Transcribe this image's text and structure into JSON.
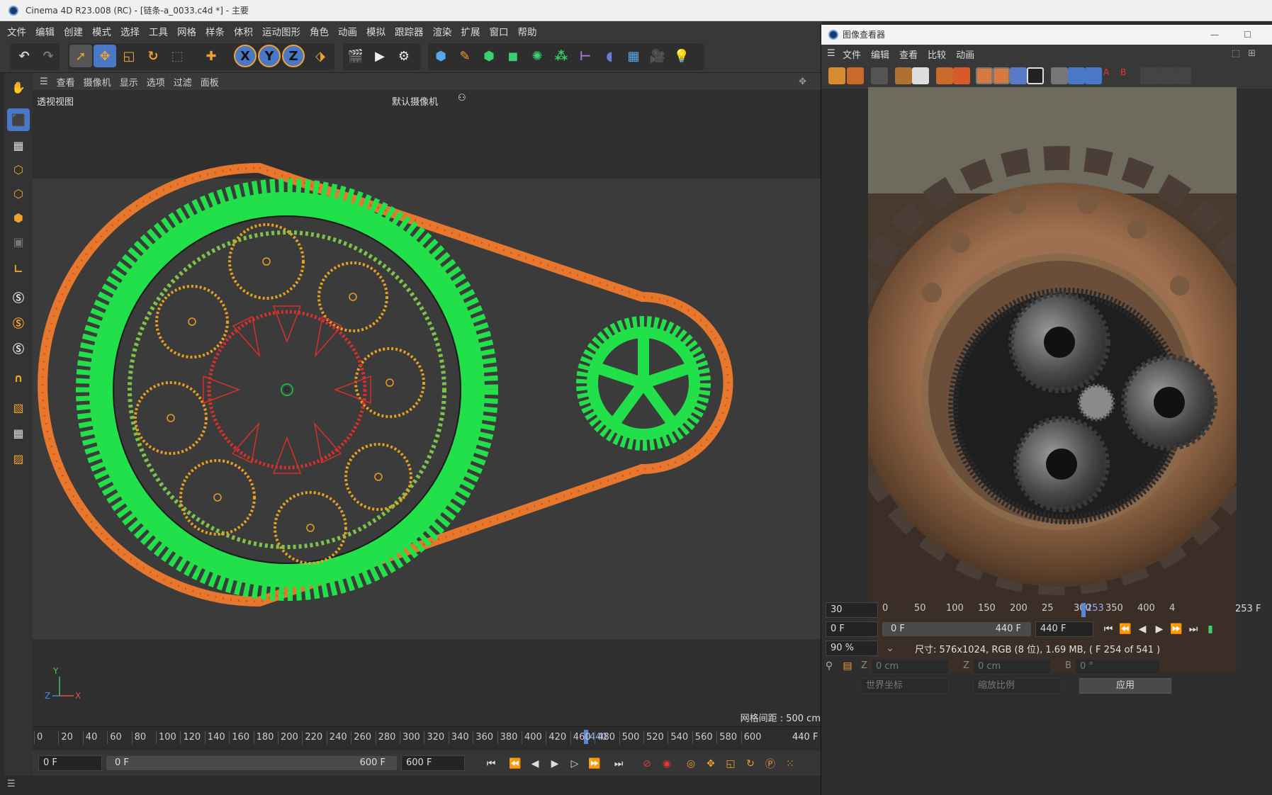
{
  "app": {
    "window_title": "Cinema 4D R23.008 (RC) - [链条-a_0033.c4d *] - 主要",
    "menu": [
      "文件",
      "编辑",
      "创建",
      "模式",
      "选择",
      "工具",
      "网格",
      "样条",
      "体积",
      "运动图形",
      "角色",
      "动画",
      "模拟",
      "跟踪器",
      "渲染",
      "扩展",
      "窗口",
      "帮助"
    ]
  },
  "toolbar": {
    "axis_x": "X",
    "axis_y": "Y",
    "axis_z": "Z"
  },
  "viewport": {
    "menu": [
      "查看",
      "摄像机",
      "显示",
      "选项",
      "过滤",
      "面板"
    ],
    "view_name": "透视视图",
    "camera_name": "默认摄像机",
    "grid_spacing": "网格间距 : 500 cm",
    "axis_x": "X",
    "axis_y": "Y",
    "axis_z": "Z"
  },
  "timeline": {
    "ticks": [
      "0",
      "20",
      "40",
      "60",
      "80",
      "100",
      "120",
      "140",
      "160",
      "180",
      "200",
      "220",
      "240",
      "260",
      "280",
      "300",
      "320",
      "340",
      "360",
      "380",
      "400",
      "420",
      "4",
      "440",
      "460",
      "480",
      "500",
      "520",
      "540",
      "560",
      "580",
      "600"
    ],
    "current_marker": "440",
    "end_label": "440 F"
  },
  "transport": {
    "start_field": "0 F",
    "range_start": "0 F",
    "range_end": "600 F",
    "end_field": "600 F"
  },
  "viewer": {
    "title": "图像查看器",
    "menu": [
      "文件",
      "编辑",
      "查看",
      "比较",
      "动画"
    ],
    "fps": "30",
    "ticks": [
      "0",
      "50",
      "100",
      "150",
      "200",
      "25",
      "253",
      "300",
      "350",
      "400",
      "4"
    ],
    "current_frame": "253 F",
    "frame_start": "0 F",
    "frame_end_bar": "440 F",
    "frame_end_field": "440 F",
    "zoom": "90 %",
    "info": "尺寸: 576x1024, RGB (8 位), 1.69 MB, ( F 254 of 541 )",
    "coord_z1_label": "Z",
    "coord_z1_value": "0 cm",
    "coord_z2_label": "Z",
    "coord_z2_value": "0 cm",
    "coord_b_label": "B",
    "coord_b_value": "0 °",
    "world_coord": "世界坐标",
    "scale": "缩放比例",
    "apply": "应用"
  },
  "colors": {
    "chain": "#e8772e",
    "sprocket": "#22e04a",
    "planet_gear": "#e8a020",
    "sun_gear": "#d8302a",
    "ring_gear": "#7dc24a"
  }
}
